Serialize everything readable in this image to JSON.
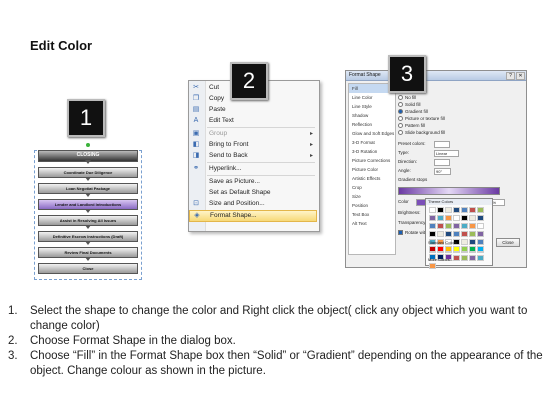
{
  "title": "Edit Color",
  "badges": [
    "1",
    "2",
    "3"
  ],
  "flowchart": {
    "boxes": [
      "CLOSING",
      "Coordinate Due Diligence",
      "Loan Negotiat Package",
      "Lender and Landlord Introductions",
      "Assist in Resolving All Issues",
      "Definitive Escrow Instructions (Draft)",
      "Review Final Documents",
      "Close"
    ],
    "selected_index": 3
  },
  "context_menu": {
    "items": [
      {
        "label": "Cut",
        "icon": "scissors-icon",
        "glyph": "✂"
      },
      {
        "label": "Copy",
        "icon": "copy-icon",
        "glyph": "❐"
      },
      {
        "label": "Paste",
        "icon": "paste-icon",
        "glyph": "▤"
      },
      {
        "label": "Edit Text",
        "icon": "edit-text-icon",
        "glyph": "A"
      },
      {
        "label": "Group",
        "icon": "group-icon",
        "glyph": "▣",
        "disabled": true,
        "submenu": true
      },
      {
        "label": "Bring to Front",
        "icon": "bring-front-icon",
        "glyph": "◧",
        "submenu": true
      },
      {
        "label": "Send to Back",
        "icon": "send-back-icon",
        "glyph": "◨",
        "submenu": true
      },
      {
        "label": "Hyperlink...",
        "icon": "hyperlink-icon",
        "glyph": "⚭"
      },
      {
        "label": "Save as Picture...",
        "icon": "",
        "glyph": ""
      },
      {
        "label": "Set as Default Shape",
        "icon": "",
        "glyph": ""
      },
      {
        "label": "Size and Position...",
        "icon": "size-position-icon",
        "glyph": "⊡"
      },
      {
        "label": "Format Shape...",
        "icon": "format-shape-icon",
        "glyph": "◈",
        "highlight": true
      }
    ]
  },
  "format_dialog": {
    "title": "Format Shape",
    "categories": [
      "Fill",
      "Line Color",
      "Line Style",
      "Shadow",
      "Reflection",
      "Glow and Soft Edges",
      "3-D Format",
      "3-D Rotation",
      "Picture Corrections",
      "Picture Color",
      "Artistic Effects",
      "Crop",
      "Size",
      "Position",
      "Text Box",
      "Alt Text"
    ],
    "fill_options": [
      "No fill",
      "Solid fill",
      "Gradient fill",
      "Picture or texture fill",
      "Pattern fill",
      "Slide background fill"
    ],
    "selected_fill": "Gradient fill",
    "fields": {
      "preset_label": "Preset colors:",
      "type_label": "Type:",
      "type_value": "Linear",
      "direction_label": "Direction:",
      "angle_label": "Angle:",
      "angle_value": "90°",
      "stops_label": "Gradient stops",
      "color_label": "Color",
      "position_label": "Position:",
      "position_value": "50%",
      "brightness_label": "Brightness:",
      "transparency_label": "Transparency:",
      "rotate_label": "Rotate with shape"
    },
    "close_label": "Close",
    "palette": {
      "theme_title": "Theme Colors",
      "standard_title": "Standard Colors",
      "more_label": "More Colors...",
      "theme_colors": [
        "#ffffff",
        "#000000",
        "#eeece1",
        "#1f497d",
        "#4f81bd",
        "#c0504d",
        "#9bbb59",
        "#8064a2",
        "#4bacc6",
        "#f79646"
      ],
      "standard_colors": [
        "#c00000",
        "#ff0000",
        "#ffc000",
        "#ffff00",
        "#92d050",
        "#00b050",
        "#00b0f0",
        "#0070c0",
        "#002060",
        "#7030a0"
      ]
    }
  },
  "instructions": [
    {
      "num": "1.",
      "text": "Select the shape to change the color and Right click the object( click any object which you want to change color)"
    },
    {
      "num": "2.",
      "text": "Choose Format Shape in the dialog box."
    },
    {
      "num": "3.",
      "text": "Choose “Fill” in the Format Shape box then “Solid” or “Gradient” depending on the appearance of the object. Change colour as shown in the picture."
    }
  ]
}
